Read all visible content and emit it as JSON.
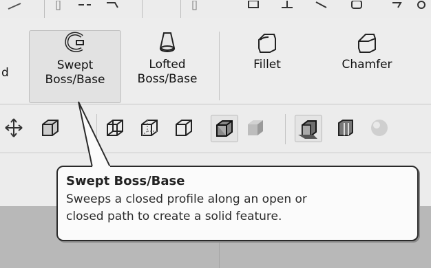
{
  "ribbon": {
    "partial_left_label": "d",
    "commands": [
      {
        "name": "swept-boss-base-button",
        "icon": "swept-boss-icon",
        "line1": "Swept",
        "line2": "Boss/Base"
      },
      {
        "name": "lofted-boss-base-button",
        "icon": "lofted-boss-icon",
        "line1": "Lofted",
        "line2": "Boss/Base"
      },
      {
        "name": "fillet-button",
        "icon": "fillet-icon",
        "line1": "Fillet",
        "line2": ""
      },
      {
        "name": "chamfer-button",
        "icon": "chamfer-icon",
        "line1": "Chamfer",
        "line2": ""
      }
    ]
  },
  "view_toolbar": {
    "icons": [
      "pan-icon",
      "view-orientation-icon",
      "wireframe-icon",
      "hidden-lines-visible-icon",
      "hidden-lines-removed-icon",
      "shaded-with-edges-icon",
      "shaded-icon",
      "section-view-icon",
      "display-style-icon",
      "hide-show-items-icon",
      "appearance-icon"
    ]
  },
  "tooltip": {
    "title": "Swept Boss/Base",
    "line1": "Sweeps a closed profile along an open or",
    "line2": "closed path to create a solid feature."
  },
  "colors": {
    "toolbar_bg": "#ececec",
    "graphics_bg": "#b8b8b8",
    "tooltip_border": "#2a2a2a"
  }
}
